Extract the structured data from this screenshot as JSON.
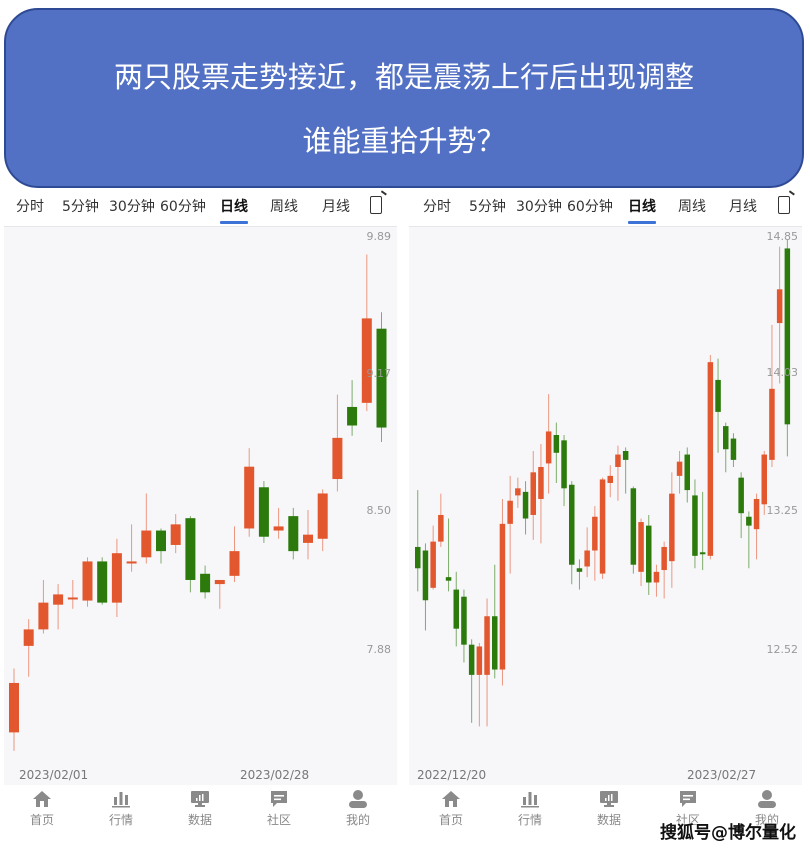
{
  "banner": {
    "line1": "两只股票走势接近，都是震荡上行后出现调整",
    "line2": "谁能重拾升势？",
    "color": "#5271c4"
  },
  "tabs": [
    "分时",
    "5分钟",
    "30分钟",
    "60分钟",
    "日线",
    "周线",
    "月线"
  ],
  "active_tab": "日线",
  "nav": [
    {
      "label": "首页",
      "icon": "home-icon"
    },
    {
      "label": "行情",
      "icon": "bar-chart-icon"
    },
    {
      "label": "数据",
      "icon": "monitor-chart-icon"
    },
    {
      "label": "社区",
      "icon": "chat-bubble-icon"
    },
    {
      "label": "我的",
      "icon": "user-icon"
    }
  ],
  "watermark": "搜狐号@博尔量化",
  "colors": {
    "up": "#e2572e",
    "down": "#2b7a0b",
    "accent": "#3d72d6"
  },
  "chart_data": [
    {
      "type": "candlestick",
      "title": "",
      "y_ticks": [
        "9.89",
        "9.17",
        "8.50",
        "7.88"
      ],
      "ylim": [
        7.28,
        9.89
      ],
      "x_labels": {
        "start": "2023/02/01",
        "end": "2023/02/28"
      },
      "grid": false,
      "candles": [
        {
          "o": 7.48,
          "c": 7.72,
          "h": 7.79,
          "l": 7.39
        },
        {
          "o": 7.9,
          "c": 7.98,
          "h": 8.03,
          "l": 7.75
        },
        {
          "o": 7.98,
          "c": 8.11,
          "h": 8.22,
          "l": 7.96
        },
        {
          "o": 8.1,
          "c": 8.15,
          "h": 8.2,
          "l": 7.98
        },
        {
          "o": 8.13,
          "c": 8.135,
          "h": 8.22,
          "l": 8.08
        },
        {
          "o": 8.12,
          "c": 8.31,
          "h": 8.33,
          "l": 8.09
        },
        {
          "o": 8.31,
          "c": 8.11,
          "h": 8.33,
          "l": 8.1
        },
        {
          "o": 8.11,
          "c": 8.35,
          "h": 8.42,
          "l": 8.04
        },
        {
          "o": 8.3,
          "c": 8.31,
          "h": 8.49,
          "l": 8.26
        },
        {
          "o": 8.33,
          "c": 8.46,
          "h": 8.64,
          "l": 8.3
        },
        {
          "o": 8.46,
          "c": 8.36,
          "h": 8.47,
          "l": 8.3
        },
        {
          "o": 8.39,
          "c": 8.49,
          "h": 8.54,
          "l": 8.35
        },
        {
          "o": 8.52,
          "c": 8.22,
          "h": 8.53,
          "l": 8.16
        },
        {
          "o": 8.25,
          "c": 8.16,
          "h": 8.29,
          "l": 8.13
        },
        {
          "o": 8.2,
          "c": 8.22,
          "h": 8.22,
          "l": 8.08
        },
        {
          "o": 8.24,
          "c": 8.36,
          "h": 8.48,
          "l": 8.21
        },
        {
          "o": 8.47,
          "c": 8.77,
          "h": 8.86,
          "l": 8.43
        },
        {
          "o": 8.67,
          "c": 8.43,
          "h": 8.7,
          "l": 8.4
        },
        {
          "o": 8.46,
          "c": 8.48,
          "h": 8.57,
          "l": 8.42
        },
        {
          "o": 8.53,
          "c": 8.36,
          "h": 8.57,
          "l": 8.32
        },
        {
          "o": 8.4,
          "c": 8.44,
          "h": 8.56,
          "l": 8.32
        },
        {
          "o": 8.42,
          "c": 8.64,
          "h": 8.66,
          "l": 8.36
        },
        {
          "o": 8.71,
          "c": 8.91,
          "h": 9.12,
          "l": 8.65
        },
        {
          "o": 9.06,
          "c": 8.97,
          "h": 9.19,
          "l": 8.92
        },
        {
          "o": 9.08,
          "c": 9.49,
          "h": 9.8,
          "l": 9.04
        },
        {
          "o": 9.44,
          "c": 8.96,
          "h": 9.52,
          "l": 8.89
        }
      ]
    },
    {
      "type": "candlestick",
      "title": "",
      "y_ticks": [
        "14.85",
        "14.03",
        "13.25",
        "12.52"
      ],
      "ylim": [
        11.88,
        14.85
      ],
      "x_labels": {
        "start": "2022/12/20",
        "end": "2023/02/27"
      },
      "grid": false,
      "candles": [
        {
          "o": 13.1,
          "c": 12.98,
          "h": 13.42,
          "l": 12.85
        },
        {
          "o": 13.08,
          "c": 12.8,
          "h": 13.12,
          "l": 12.63
        },
        {
          "o": 12.87,
          "c": 13.13,
          "h": 13.22,
          "l": 12.86
        },
        {
          "o": 13.13,
          "c": 13.28,
          "h": 13.4,
          "l": 13.1
        },
        {
          "o": 12.93,
          "c": 12.91,
          "h": 13.26,
          "l": 12.85
        },
        {
          "o": 12.86,
          "c": 12.64,
          "h": 12.96,
          "l": 12.54
        },
        {
          "o": 12.82,
          "c": 12.55,
          "h": 12.86,
          "l": 12.45
        },
        {
          "o": 12.55,
          "c": 12.38,
          "h": 12.58,
          "l": 12.11
        },
        {
          "o": 12.38,
          "c": 12.54,
          "h": 12.56,
          "l": 12.09
        },
        {
          "o": 12.38,
          "c": 12.71,
          "h": 12.81,
          "l": 12.09
        },
        {
          "o": 12.71,
          "c": 12.41,
          "h": 13.0,
          "l": 12.36
        },
        {
          "o": 12.41,
          "c": 13.23,
          "h": 13.37,
          "l": 12.32
        },
        {
          "o": 13.23,
          "c": 13.36,
          "h": 13.5,
          "l": 12.95
        },
        {
          "o": 13.39,
          "c": 13.43,
          "h": 13.49,
          "l": 13.32
        },
        {
          "o": 13.41,
          "c": 13.26,
          "h": 13.47,
          "l": 13.17
        },
        {
          "o": 13.28,
          "c": 13.52,
          "h": 13.64,
          "l": 13.14
        },
        {
          "o": 13.37,
          "c": 13.55,
          "h": 13.68,
          "l": 13.12
        },
        {
          "o": 13.57,
          "c": 13.75,
          "h": 13.96,
          "l": 13.4
        },
        {
          "o": 13.73,
          "c": 13.63,
          "h": 13.8,
          "l": 13.46
        },
        {
          "o": 13.7,
          "c": 13.43,
          "h": 13.73,
          "l": 13.33
        },
        {
          "o": 13.45,
          "c": 13.0,
          "h": 13.47,
          "l": 12.89
        },
        {
          "o": 12.98,
          "c": 12.96,
          "h": 13.03,
          "l": 12.86
        },
        {
          "o": 12.99,
          "c": 13.08,
          "h": 13.21,
          "l": 12.93
        },
        {
          "o": 13.08,
          "c": 13.27,
          "h": 13.33,
          "l": 12.91
        },
        {
          "o": 12.95,
          "c": 13.48,
          "h": 13.49,
          "l": 12.92
        },
        {
          "o": 13.46,
          "c": 13.5,
          "h": 13.56,
          "l": 13.38
        },
        {
          "o": 13.55,
          "c": 13.62,
          "h": 13.67,
          "l": 13.36
        },
        {
          "o": 13.64,
          "c": 13.59,
          "h": 13.66,
          "l": 13.4
        },
        {
          "o": 13.43,
          "c": 13.0,
          "h": 13.44,
          "l": 12.95
        },
        {
          "o": 12.96,
          "c": 13.24,
          "h": 13.26,
          "l": 12.88
        },
        {
          "o": 13.22,
          "c": 12.9,
          "h": 13.28,
          "l": 12.83
        },
        {
          "o": 12.9,
          "c": 12.96,
          "h": 13.0,
          "l": 12.82
        },
        {
          "o": 12.97,
          "c": 13.1,
          "h": 13.13,
          "l": 12.81
        },
        {
          "o": 13.02,
          "c": 13.4,
          "h": 13.52,
          "l": 12.87
        },
        {
          "o": 13.5,
          "c": 13.58,
          "h": 13.64,
          "l": 13.4
        },
        {
          "o": 13.62,
          "c": 13.42,
          "h": 13.66,
          "l": 13.35
        },
        {
          "o": 13.39,
          "c": 13.05,
          "h": 13.48,
          "l": 12.98
        },
        {
          "o": 13.07,
          "c": 13.06,
          "h": 13.41,
          "l": 12.97
        },
        {
          "o": 13.05,
          "c": 14.14,
          "h": 14.18,
          "l": 13.03
        },
        {
          "o": 14.04,
          "c": 13.86,
          "h": 14.16,
          "l": 13.63
        },
        {
          "o": 13.78,
          "c": 13.65,
          "h": 13.8,
          "l": 13.52
        },
        {
          "o": 13.71,
          "c": 13.59,
          "h": 13.74,
          "l": 13.55
        },
        {
          "o": 13.49,
          "c": 13.29,
          "h": 13.52,
          "l": 13.15
        },
        {
          "o": 13.27,
          "c": 13.22,
          "h": 13.3,
          "l": 12.98
        },
        {
          "o": 13.2,
          "c": 13.37,
          "h": 13.4,
          "l": 13.03
        },
        {
          "o": 13.34,
          "c": 13.62,
          "h": 13.64,
          "l": 13.28
        },
        {
          "o": 13.59,
          "c": 13.99,
          "h": 14.35,
          "l": 13.55
        },
        {
          "o": 14.36,
          "c": 14.55,
          "h": 14.79,
          "l": 14.02
        },
        {
          "o": 14.78,
          "c": 13.79,
          "h": 14.83,
          "l": 13.61
        }
      ]
    }
  ]
}
